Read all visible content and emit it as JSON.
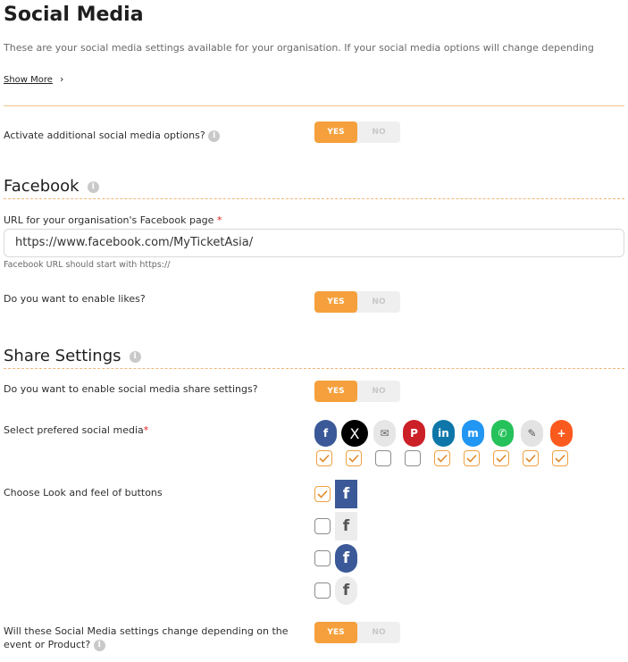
{
  "header": {
    "title": "Social Media",
    "description": "These are your social media settings available for your organisation. If your social media options will change depending",
    "show_more": "Show More",
    "show_more_icon": "chevron-right-icon"
  },
  "activate": {
    "label": "Activate additional social media options?",
    "yes": "YES",
    "no": "NO"
  },
  "facebook": {
    "title": "Facebook",
    "url_label": "URL for your organisation's Facebook page",
    "required_mark": "*",
    "url_value": "https://www.facebook.com/MyTicketAsia/",
    "url_hint": "Facebook URL should start with https://",
    "likes_label": "Do you want to enable likes?",
    "yes": "YES",
    "no": "NO"
  },
  "share": {
    "title": "Share Settings",
    "enable_label": "Do you want to enable social media share settings?",
    "yes": "YES",
    "no": "NO",
    "select_label": "Select prefered social media",
    "required_mark": "*",
    "networks": [
      {
        "name": "facebook",
        "glyph": "f",
        "color": "#3b5998",
        "checked": true
      },
      {
        "name": "x-twitter",
        "glyph": "X",
        "color": "#000000",
        "checked": true
      },
      {
        "name": "email",
        "glyph": "✉",
        "color": "#e6e6e6",
        "checked": false
      },
      {
        "name": "pinterest",
        "glyph": "P",
        "color": "#cb2027",
        "checked": false
      },
      {
        "name": "linkedin",
        "glyph": "in",
        "color": "#0e76a8",
        "checked": true
      },
      {
        "name": "messenger",
        "glyph": "m",
        "color": "#2196f3",
        "checked": true
      },
      {
        "name": "whatsapp",
        "glyph": "✆",
        "color": "#25c15a",
        "checked": true
      },
      {
        "name": "edit",
        "glyph": "✎",
        "color": "#e3e3e3",
        "checked": true
      },
      {
        "name": "more",
        "glyph": "+",
        "color": "#fb5a1e",
        "checked": true
      }
    ],
    "look_label": "Choose Look and feel of buttons",
    "looks": [
      {
        "style": "square-blue",
        "checked": true
      },
      {
        "style": "square-grey",
        "checked": false
      },
      {
        "style": "round-blue",
        "checked": false
      },
      {
        "style": "round-grey",
        "checked": false
      }
    ],
    "change_label_line1": "Will these Social Media settings change depending on the",
    "change_label_line2": "event or Product?",
    "change_yes": "YES",
    "change_no": "NO"
  },
  "colors": {
    "accent": "#f5a03c",
    "divider": "#f2c48e",
    "facebook_blue": "#3b5998"
  }
}
